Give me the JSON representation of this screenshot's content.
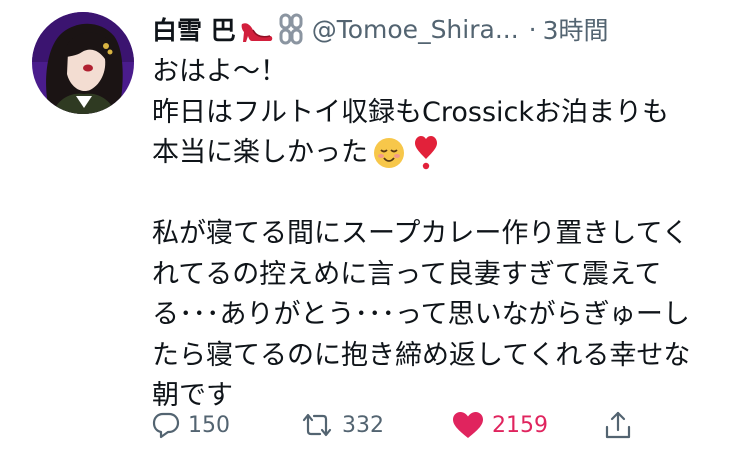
{
  "tweet": {
    "display_name": "白雪 巴",
    "name_emojis": [
      "high-heel-icon",
      "chain-icon"
    ],
    "handle": "@Tomoe_Shira...",
    "separator": "·",
    "time": "3時間",
    "lines": [
      "おはよ〜！",
      "昨日はフルトイ収録もCrossickお泊まりも",
      "本当に楽しかった",
      "",
      "私が寝てる間にスープカレー作り置きしてく",
      "れてるの控えめに言って良妻すぎて震えて",
      "る･･･ありがとう･･･って思いながらぎゅーし",
      "たら寝てるのに抱き締め返してくれる幸せな",
      "朝です"
    ],
    "line3_emojis": [
      "relieved-face-icon",
      "heart-exclamation-icon"
    ],
    "actions": {
      "replies": "150",
      "retweets": "332",
      "likes": "2159"
    },
    "colors": {
      "text": "#0f1419",
      "secondary": "#536471",
      "like": "#e0245e",
      "avatar_bg": "#4a1c8c"
    }
  }
}
